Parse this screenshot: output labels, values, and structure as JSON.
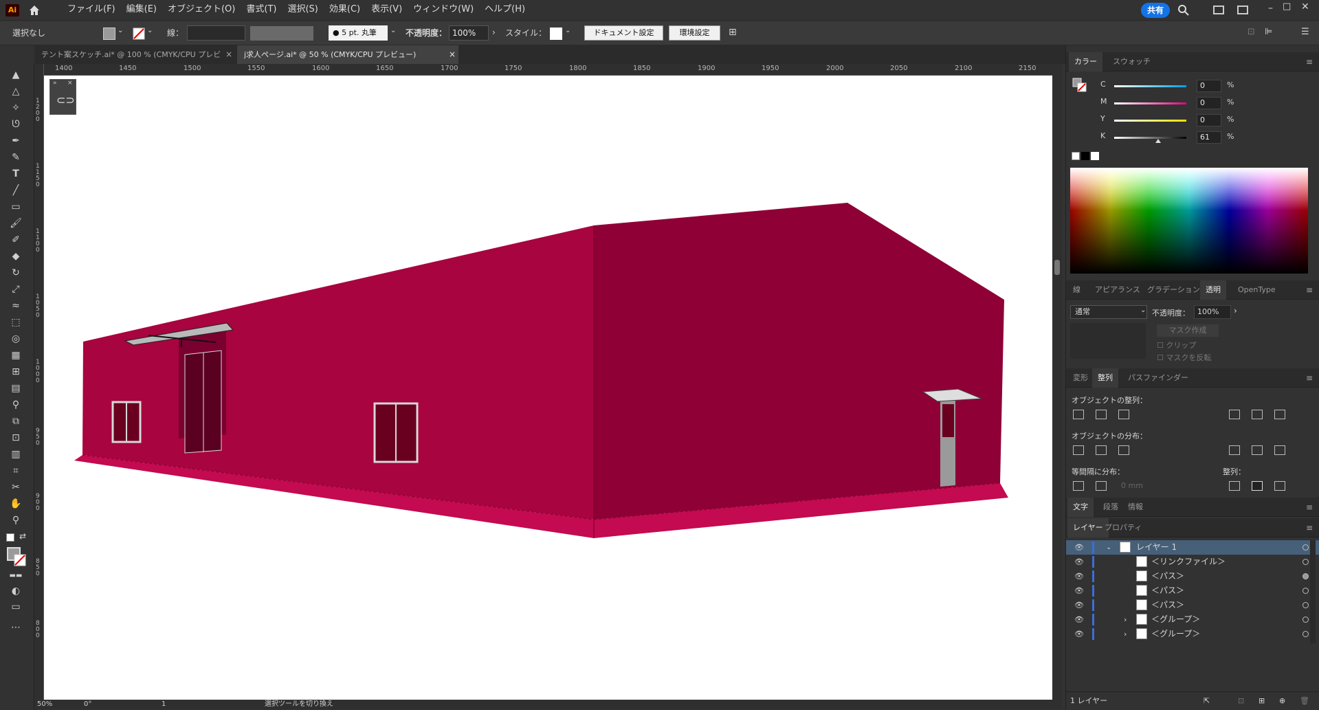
{
  "app": {
    "logo": "Ai"
  },
  "menu": [
    "ファイル(F)",
    "編集(E)",
    "オブジェクト(O)",
    "書式(T)",
    "選択(S)",
    "効果(C)",
    "表示(V)",
    "ウィンドウ(W)",
    "ヘルプ(H)"
  ],
  "share_label": "共有",
  "control": {
    "selection": "選択なし",
    "stroke_label": "線：",
    "brush": "5 pt. 丸筆",
    "opacity_label": "不透明度：",
    "opacity_value": "100%",
    "style_label": "スタイル：",
    "doc_settings": "ドキュメント設定",
    "prefs": "環境設定"
  },
  "tabs": [
    {
      "label": "テント案スケッチ.ai* @ 100 % (CMYK/CPU プレビュー)",
      "active": false
    },
    {
      "label": "j求人ページ.ai* @ 50 % (CMYK/CPU プレビュー)",
      "active": true
    }
  ],
  "ruler_h": [
    "1400",
    "1450",
    "1500",
    "1550",
    "1600",
    "1650",
    "1700",
    "1750",
    "1800",
    "1850",
    "1900",
    "1950",
    "2000",
    "2050",
    "2100",
    "2150"
  ],
  "ruler_v": [
    "1200",
    "1150",
    "1100",
    "1050",
    "1000",
    "950",
    "900",
    "850",
    "800"
  ],
  "status": {
    "zoom": "50%",
    "angle": "0°",
    "page": "1",
    "hint": "選択ツールを切り換え"
  },
  "colors": {
    "building_front": "#a8043f",
    "building_side": "#8f0036",
    "base_trim": "#c40a50",
    "window": "#6a0020"
  },
  "color_panel": {
    "tabs": [
      "カラー",
      "スウォッチ"
    ],
    "channels": [
      {
        "name": "C",
        "value": "0",
        "unit": "%",
        "level": 0
      },
      {
        "name": "M",
        "value": "0",
        "unit": "%",
        "level": 0
      },
      {
        "name": "Y",
        "value": "0",
        "unit": "%",
        "level": 0
      },
      {
        "name": "K",
        "value": "61",
        "unit": "%",
        "level": 0.61
      }
    ]
  },
  "transparency_panel": {
    "tabs": [
      "線",
      "アピアランス",
      "グラデーション",
      "透明",
      "OpenType"
    ],
    "blend": "通常",
    "opacity_label": "不透明度：",
    "opacity_value": "100%",
    "make_mask": "マスク作成",
    "clip": "クリップ",
    "invert": "マスクを反転"
  },
  "align_panel": {
    "tabs": [
      "変形",
      "整列",
      "パスファインダー"
    ],
    "align_objects": "オブジェクトの整列：",
    "distribute_objects": "オブジェクトの分布：",
    "distribute_spacing": "等間隔に分布：",
    "align_to": "整列：",
    "spacing_value": "0 mm"
  },
  "type_panel": {
    "tabs": [
      "文字",
      "段落",
      "情報"
    ]
  },
  "layers_panel": {
    "tabs": [
      "レイヤー",
      "プロパティ"
    ],
    "layer_name": "レイヤー 1",
    "items": [
      "＜リンクファイル＞",
      "＜パス＞",
      "＜パス＞",
      "＜パス＞",
      "＜グループ＞",
      "＜グループ＞"
    ],
    "footer": "1 レイヤー"
  }
}
